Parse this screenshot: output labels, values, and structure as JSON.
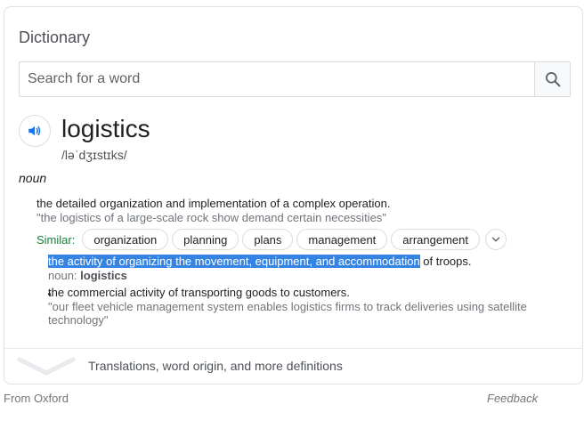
{
  "card": {
    "title": "Dictionary",
    "search": {
      "placeholder": "Search for a word"
    }
  },
  "entry": {
    "word": "logistics",
    "phonetic": "/ləˈdʒɪstɪks/",
    "part_of_speech": "noun",
    "senses": [
      {
        "definition": "the detailed organization and implementation of a complex operation.",
        "example": "\"the logistics of a large-scale rock show demand certain necessities\"",
        "similar_label": "Similar:",
        "similar": [
          "organization",
          "planning",
          "plans",
          "management",
          "arrangement"
        ]
      }
    ],
    "subsenses": [
      {
        "definition_highlighted": "the activity of organizing the movement, equipment, and accommodation",
        "definition_rest": " of troops.",
        "noun_label": "noun: ",
        "noun_word": "logistics"
      },
      {
        "definition": "the commercial activity of transporting goods to customers.",
        "example_line1": "\"our fleet vehicle management system enables logistics firms to track deliveries using satellite",
        "example_line2": "technology\""
      }
    ]
  },
  "more": {
    "label": "Translations, word origin, and more definitions"
  },
  "footer": {
    "source": "From Oxford",
    "feedback": "Feedback"
  },
  "colors": {
    "accent": "#1a73e8",
    "similar": "#188038",
    "highlight": "#3584e4"
  },
  "icons": {
    "search": "search-icon",
    "speaker": "speaker-icon",
    "expand": "chevron-down-icon",
    "more": "chevron-down-icon"
  }
}
